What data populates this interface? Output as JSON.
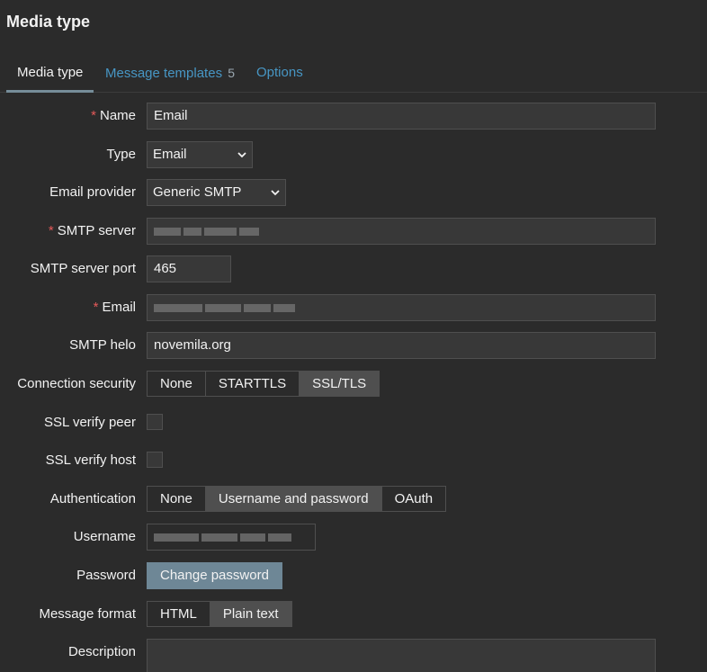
{
  "page": {
    "title": "Media type"
  },
  "tabs": [
    {
      "label": "Media type",
      "count": ""
    },
    {
      "label": "Message templates",
      "count": "5"
    },
    {
      "label": "Options",
      "count": ""
    }
  ],
  "form": {
    "name": {
      "label": "Name",
      "value": "Email"
    },
    "type": {
      "label": "Type",
      "value": "Email"
    },
    "email_provider": {
      "label": "Email provider",
      "value": "Generic SMTP"
    },
    "smtp_server": {
      "label": "SMTP server"
    },
    "smtp_server_port": {
      "label": "SMTP server port",
      "value": "465"
    },
    "email": {
      "label": "Email"
    },
    "smtp_helo": {
      "label": "SMTP helo",
      "value": "novemila.org"
    },
    "connection_security": {
      "label": "Connection security",
      "options": [
        "None",
        "STARTTLS",
        "SSL/TLS"
      ],
      "selected": "SSL/TLS"
    },
    "ssl_verify_peer": {
      "label": "SSL verify peer",
      "checked": false
    },
    "ssl_verify_host": {
      "label": "SSL verify host",
      "checked": false
    },
    "authentication": {
      "label": "Authentication",
      "options": [
        "None",
        "Username and password",
        "OAuth"
      ],
      "selected": "Username and password"
    },
    "username": {
      "label": "Username"
    },
    "password": {
      "label": "Password",
      "button": "Change password"
    },
    "message_format": {
      "label": "Message format",
      "options": [
        "HTML",
        "Plain text"
      ],
      "selected": "Plain text"
    },
    "description": {
      "label": "Description",
      "value": ""
    }
  },
  "colors": {
    "background": "#2b2b2b",
    "input_bg": "#383838",
    "border": "#4f4f4f",
    "link": "#4796c4",
    "required": "#e45959",
    "primary_button": "#6e8796",
    "selected_segment": "#4f4f4f"
  }
}
